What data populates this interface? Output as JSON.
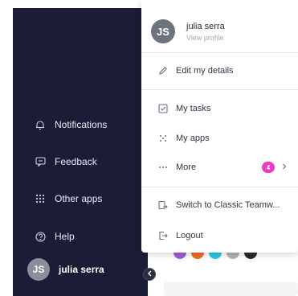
{
  "sidebar": {
    "items": [
      {
        "label": "Notifications",
        "icon": "bell-icon"
      },
      {
        "label": "Feedback",
        "icon": "chat-bubble-icon"
      },
      {
        "label": "Other apps",
        "icon": "grid-dots-icon"
      },
      {
        "label": "Help",
        "icon": "help-circle-icon"
      }
    ],
    "user": {
      "initials": "JS",
      "name": "julia serra"
    },
    "collapse_icon": "chevron-left-icon"
  },
  "menu": {
    "header": {
      "initials": "JS",
      "name": "julia serra",
      "subtitle": "View profile"
    },
    "items": [
      {
        "label": "Edit my details",
        "icon": "pencil-icon"
      },
      {
        "label": "My tasks",
        "icon": "checkbox-icon"
      },
      {
        "label": "My apps",
        "icon": "apps-dots-icon"
      },
      {
        "label": "More",
        "icon": "ellipsis-icon",
        "badge": "4",
        "chevron": "chevron-right-icon"
      },
      {
        "label": "Switch to Classic Teamw...",
        "icon": "switch-icon"
      },
      {
        "label": "Logout",
        "icon": "logout-icon"
      }
    ]
  },
  "colors": {
    "sidebar_bg": "#1b1d36",
    "badge": "#e93fbb",
    "avatar_strip": [
      "#a35bd6",
      "#ef6b2a",
      "#2ec4e6",
      "#b0b3bd",
      "#2a2a2a"
    ]
  }
}
